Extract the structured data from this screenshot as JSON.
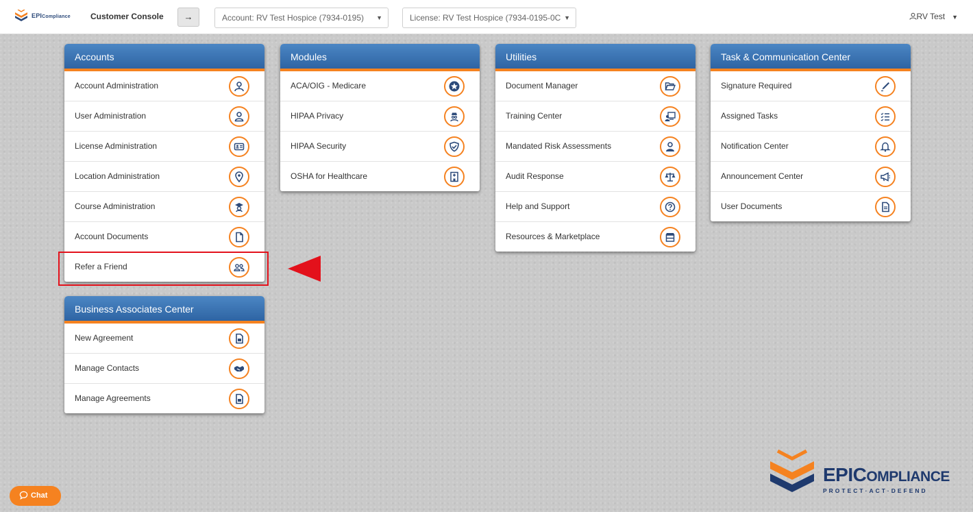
{
  "topbar": {
    "brand_prefix": "EPI",
    "brand_suffix": "Compliance",
    "console_title": "Customer Console",
    "arrow_label": "→",
    "account_select": "Account: RV Test Hospice (7934-0195)",
    "license_select": "License: RV Test Hospice (7934-0195-0C",
    "user_name": "RV Test"
  },
  "panels": {
    "accounts": {
      "title": "Accounts",
      "items": [
        {
          "label": "Account Administration",
          "icon": "account-admin-icon"
        },
        {
          "label": "User Administration",
          "icon": "user-icon"
        },
        {
          "label": "License Administration",
          "icon": "id-card-icon"
        },
        {
          "label": "Location Administration",
          "icon": "location-pin-icon"
        },
        {
          "label": "Course Administration",
          "icon": "course-icon"
        },
        {
          "label": "Account Documents",
          "icon": "document-icon"
        },
        {
          "label": "Refer a Friend",
          "icon": "users-icon"
        }
      ]
    },
    "business": {
      "title": "Business Associates Center",
      "items": [
        {
          "label": "New Agreement",
          "icon": "agreement-icon"
        },
        {
          "label": "Manage Contacts",
          "icon": "handshake-icon"
        },
        {
          "label": "Manage Agreements",
          "icon": "agreement-icon"
        }
      ]
    },
    "modules": {
      "title": "Modules",
      "items": [
        {
          "label": "ACA/OIG - Medicare",
          "icon": "star-icon"
        },
        {
          "label": "HIPAA Privacy",
          "icon": "privacy-icon"
        },
        {
          "label": "HIPAA Security",
          "icon": "shield-icon"
        },
        {
          "label": "OSHA for Healthcare",
          "icon": "hospital-icon"
        }
      ]
    },
    "utilities": {
      "title": "Utilities",
      "items": [
        {
          "label": "Document Manager",
          "icon": "folder-open-icon"
        },
        {
          "label": "Training Center",
          "icon": "training-icon"
        },
        {
          "label": "Mandated Risk Assessments",
          "icon": "assessor-icon"
        },
        {
          "label": "Audit Response",
          "icon": "scale-icon"
        },
        {
          "label": "Help and Support",
          "icon": "question-icon"
        },
        {
          "label": "Resources & Marketplace",
          "icon": "store-icon"
        }
      ]
    },
    "tasks": {
      "title": "Task & Communication Center",
      "items": [
        {
          "label": "Signature Required",
          "icon": "pen-icon"
        },
        {
          "label": "Assigned Tasks",
          "icon": "task-list-icon"
        },
        {
          "label": "Notification Center",
          "icon": "bell-icon"
        },
        {
          "label": "Announcement Center",
          "icon": "megaphone-icon"
        },
        {
          "label": "User Documents",
          "icon": "user-document-icon"
        }
      ]
    }
  },
  "chat": {
    "label": "Chat"
  },
  "footer_logo": {
    "brand_prefix": "EPI",
    "brand_c": "C",
    "brand_rest": "OMPLIANCE",
    "tagline": "PROTECT·ACT·DEFEND"
  },
  "colors": {
    "accent": "#f58220",
    "header_blue": "#2e64a3",
    "highlight": "#e3111b",
    "brand_navy": "#1f3a6e"
  }
}
